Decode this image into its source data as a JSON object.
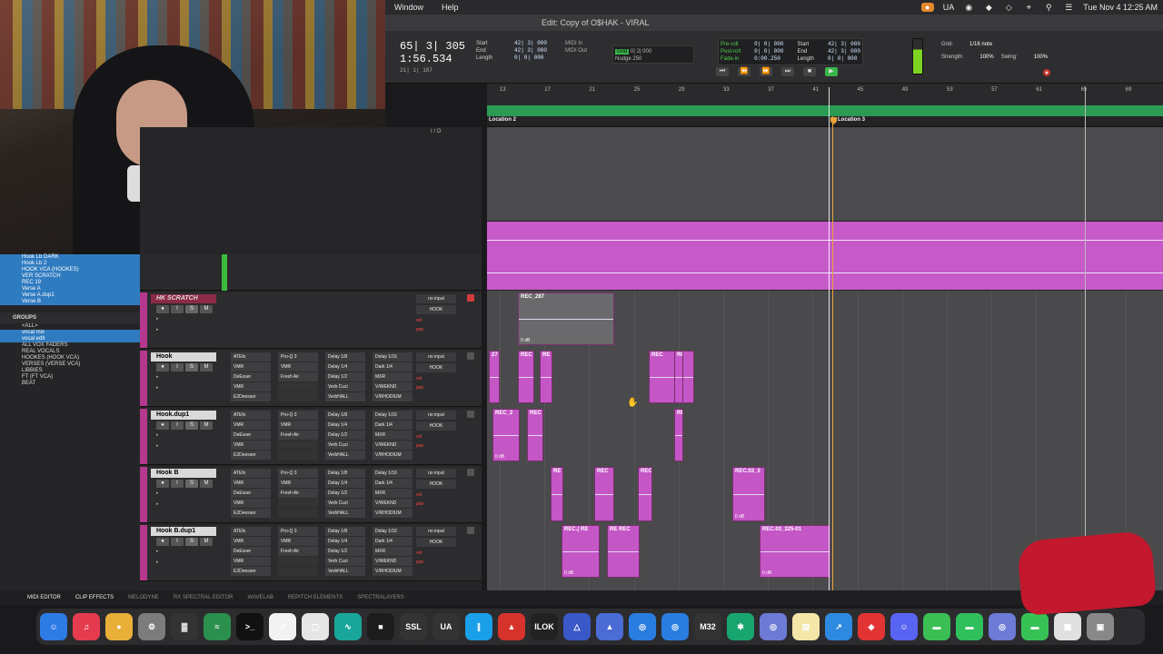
{
  "menubar": {
    "items": [
      "Window",
      "Help"
    ],
    "status": [
      "UA"
    ],
    "clock": "Tue Nov 4  12:25 AM"
  },
  "window": {
    "title": "Edit: Copy of O$HAK - VIRAL"
  },
  "transport": {
    "main_counter": "65| 3| 305",
    "sub_counter": "1:56.534",
    "cursor": "21| 1| 187",
    "start_labels": [
      "Start",
      "End",
      "Length"
    ],
    "start_values": [
      "42| 3| 000",
      "42| 3| 000",
      "0| 0| 000"
    ],
    "midi_labels": [
      "MIDI In",
      "MIDI Out"
    ],
    "grid_label": "Grid",
    "grid_value": "0| 2| 000",
    "nudge_label": "Nudge",
    "nudge_value": "250",
    "preroll_labels": [
      "Pre-roll",
      "Post-roll",
      "Fade-in"
    ],
    "preroll_values": [
      "0| 0| 000",
      "0| 0| 000",
      "0:00.250"
    ],
    "pr_start_labels": [
      "Start",
      "End",
      "Length"
    ],
    "pr_start_values": [
      "42| 3| 000",
      "42| 3| 000",
      "0| 0| 000"
    ],
    "buttons": [
      "⏮",
      "⏪",
      "⏩",
      "⏭",
      "■",
      "▶",
      "●"
    ],
    "grid_ctl": {
      "grid": "Grid:",
      "grid_val": "1/16 note",
      "strength": "Strength:",
      "strength_val": "100%",
      "swing": "Swing:",
      "swing_val": "100%"
    }
  },
  "ruler": {
    "bars": [
      "13",
      "17",
      "21",
      "25",
      "29",
      "33",
      "37",
      "41",
      "45",
      "49",
      "53",
      "57",
      "61",
      "65",
      "69"
    ],
    "locations": [
      "Location 2",
      "Location 3"
    ]
  },
  "left_list": {
    "tracks": [
      "Hook Lb DARK",
      "Hook Lb 2",
      "HOOK VCA (HOOKES)",
      "VER SCRATCH",
      "REC 19",
      "Verse A",
      "Verse A.dup1",
      "Verse B"
    ],
    "groups_title": "GROUPS",
    "groups": [
      "<ALL>",
      "vocal mix",
      "vocal edit",
      "ALL VOX FADERS",
      "REAL VOCALS",
      "HOOKES (HOOK VCA)",
      "VERSES (VERSE VCA)",
      "LIBBIES",
      "FT (FT VCA)",
      "BEAT"
    ]
  },
  "track_header": {
    "io_title": "I / O"
  },
  "tracks": [
    {
      "name": "HK SCRATCH",
      "rec": true
    },
    {
      "name": "Hook",
      "rec": false
    },
    {
      "name": "Hook.dup1",
      "rec": false
    },
    {
      "name": "Hook B",
      "rec": false
    },
    {
      "name": "Hook B.dup1",
      "rec": false
    }
  ],
  "inserts_a": [
    "ATEfx",
    "VMR",
    "DeEsser",
    "VMR",
    "E2Deesser"
  ],
  "inserts_b": [
    "Pro-Q 3",
    "VMR",
    "Fresh Air",
    "",
    ""
  ],
  "inserts_c": [
    "Delay 1/8",
    "Delay 1/4",
    "Delay 1/2",
    "Verb Cuzi",
    "VerbHALL"
  ],
  "inserts_d": [
    "Delay 1/16",
    "Dark 1/4",
    "MXR",
    "V/WEKND",
    "V/RHODIUM"
  ],
  "io": {
    "input": "no input",
    "output": "HOOK",
    "vol": "vol",
    "pan": "pan"
  },
  "clips": [
    {
      "name": "REC_287",
      "db": "0 dB"
    },
    {
      "name": "27",
      "db": ""
    },
    {
      "name": "REC",
      "db": ""
    },
    {
      "name": "RE",
      "db": ""
    },
    {
      "name": "REC",
      "db": ""
    },
    {
      "name": "RE",
      "db": ""
    },
    {
      "name": "REC_2",
      "db": "0 dB"
    },
    {
      "name": "REC",
      "db": ""
    },
    {
      "name": "RE",
      "db": ""
    },
    {
      "name": "RE",
      "db": ""
    },
    {
      "name": "REC",
      "db": ""
    },
    {
      "name": "REC",
      "db": ""
    },
    {
      "name": "REC.03_3",
      "db": "0 dB"
    },
    {
      "name": "REC.( RE",
      "db": "0 dB"
    },
    {
      "name": "RE REC",
      "db": ""
    },
    {
      "name": "REC.03_325-01",
      "db": "0 dB"
    }
  ],
  "bottom_tabs": [
    "MIDI EDITOR",
    "CLIP EFFECTS",
    "MELODYNE",
    "RX SPECTRAL EDITOR",
    "WAVELAB",
    "REPITCH ELEMENTS",
    "SPECTRALAYERS"
  ],
  "dock": [
    "☺",
    "♫",
    "●",
    "⚙",
    "▓",
    "≈",
    ">_",
    "↗",
    "▢",
    "∿",
    "■",
    "SSL",
    "UA",
    "∥",
    "▲",
    "ILOK",
    "△",
    "▲",
    "◎",
    "◎",
    "M32",
    "✱",
    "◎",
    "▤",
    "↗",
    "◆",
    "☺",
    "▬",
    "▬",
    "◎",
    "▬",
    "▦",
    "▣"
  ],
  "colors": {
    "accent_pink": "#c456c6",
    "marker_green": "#2b9a52",
    "location_orange": "#e8a33a"
  }
}
